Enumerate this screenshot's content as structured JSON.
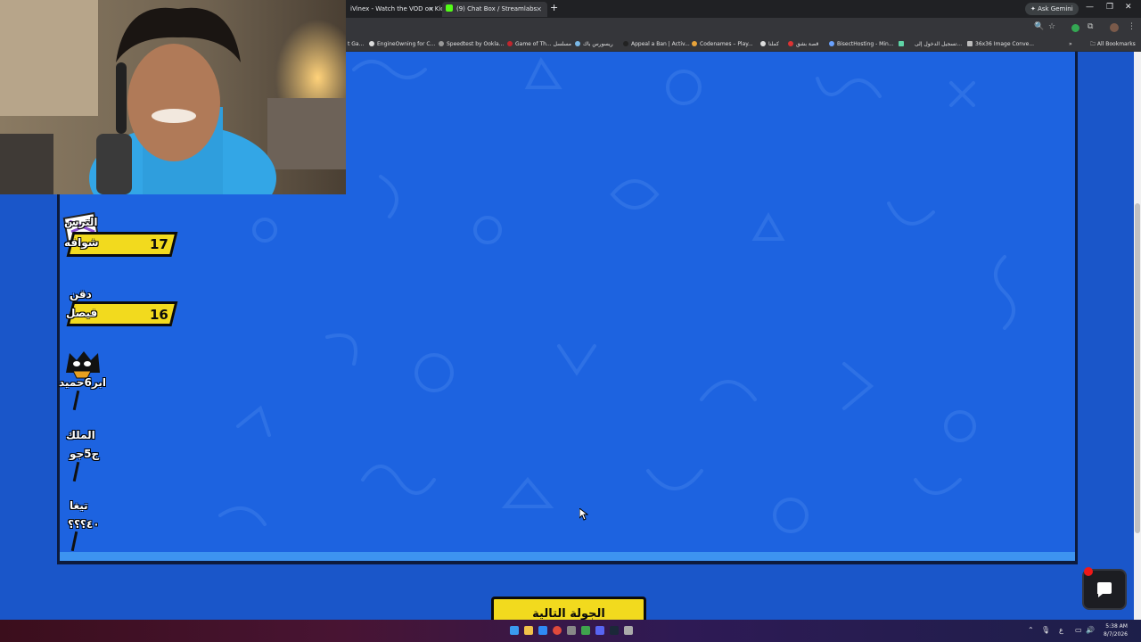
{
  "browser": {
    "tabs": [
      {
        "label": "iVinex - Watch the VOD on Kick",
        "active": false
      },
      {
        "label": "(9) Chat Box / Streamlabs",
        "active": true
      }
    ],
    "new_tab": "+",
    "ask_gemini": "Ask Gemini",
    "bookmarks": [
      "t Ga...",
      "EngineOwning for C...",
      "Speedtest by Ookla...",
      "Game of Th... مسلسل",
      "ريسورس باك",
      "Appeal a Ban | Activ...",
      "Codenames – Play...",
      "كملنا",
      "قصة بشق",
      "BisectHosting - Min...",
      "",
      "تسجيل الدخول إلى...",
      "36x36 Image Conve..."
    ],
    "all_bookmarks": "All Bookmarks"
  },
  "game": {
    "players": [
      {
        "name_line1": "الترس",
        "name_line2": "شوافه",
        "score": "17"
      },
      {
        "name_line1": "دقن",
        "name_line2": "فيصل",
        "score": "16"
      },
      {
        "name_line1": "",
        "name_line2": "ابر6حميد",
        "score": ""
      },
      {
        "name_line1": "الملك",
        "name_line2": "ج5جو",
        "score": ""
      },
      {
        "name_line1": "تيغا",
        "name_line2": "٤٠؟؟؟",
        "score": ""
      }
    ],
    "next_round_label": "الجولة التالية"
  },
  "taskbar": {
    "time": "5:38 AM",
    "date": "8/7/2026",
    "language": "ع"
  },
  "colors": {
    "background": "#1a56c9",
    "panel": "#1d63e0",
    "accent_yellow": "#f2da1e",
    "chat_notification": "#f01818"
  }
}
